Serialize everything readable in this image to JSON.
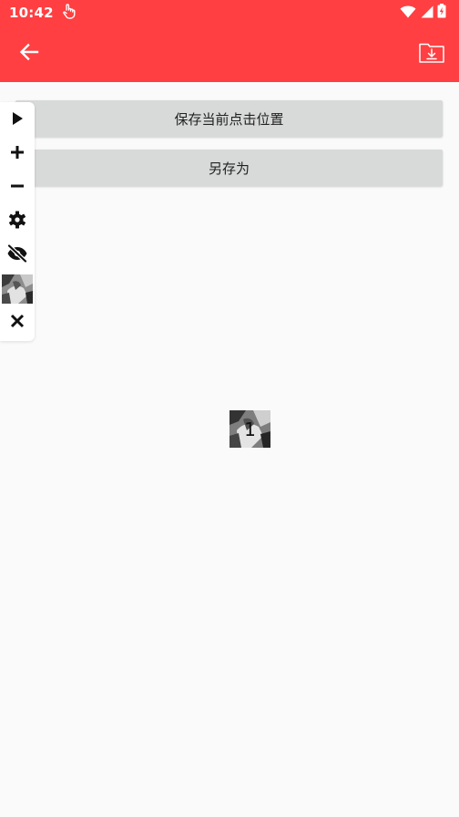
{
  "status_bar": {
    "time": "10:42",
    "icons": [
      "touch-icon",
      "wifi-icon",
      "signal-icon",
      "battery-charging-icon"
    ]
  },
  "app_bar": {
    "background": "#ff3f42",
    "back_icon": "arrow-left-icon",
    "save_icon": "folder-download-icon"
  },
  "main": {
    "save_position_label": "保存当前点击位置",
    "save_as_label": "另存为"
  },
  "floating_toolbar": {
    "items": [
      "play-icon",
      "plus-icon",
      "minus-icon",
      "gear-icon",
      "eye-off-icon",
      "thumbnail-image",
      "close-icon"
    ]
  },
  "click_marker": {
    "label": "1"
  }
}
